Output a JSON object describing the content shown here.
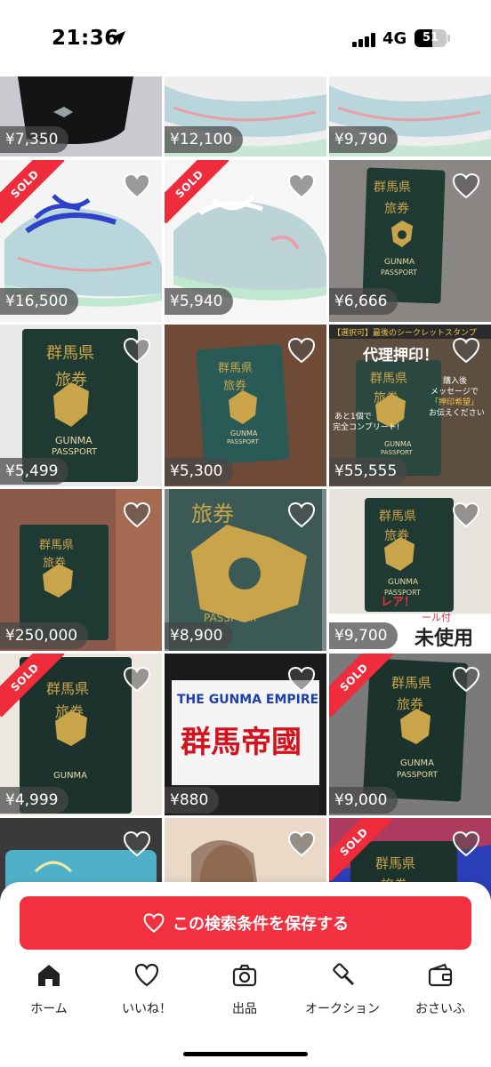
{
  "status_bar": {
    "time": "21:36",
    "network": "4G",
    "battery": "51"
  },
  "items": [
    {
      "price": "¥7,350",
      "sold": false
    },
    {
      "price": "¥12,100",
      "sold": false
    },
    {
      "price": "¥9,790",
      "sold": false
    },
    {
      "price": "¥16,500",
      "sold": true
    },
    {
      "price": "¥5,940",
      "sold": true
    },
    {
      "price": "¥6,666",
      "sold": false
    },
    {
      "price": "¥5,499",
      "sold": false
    },
    {
      "price": "¥5,300",
      "sold": false
    },
    {
      "price": "¥55,555",
      "sold": false
    },
    {
      "price": "¥250,000",
      "sold": false
    },
    {
      "price": "¥8,900",
      "sold": false
    },
    {
      "price": "¥9,700",
      "sold": false
    },
    {
      "price": "¥4,999",
      "sold": true
    },
    {
      "price": "¥880",
      "sold": false
    },
    {
      "price": "¥9,000",
      "sold": true
    },
    {
      "price": "",
      "sold": false
    },
    {
      "price": "",
      "sold": false
    },
    {
      "price": "",
      "sold": true
    }
  ],
  "sold_label": "SOLD",
  "passport_text": {
    "line1": "群馬県",
    "line2": "旅券",
    "en1": "GUNMA",
    "en2": "PASSPORT"
  },
  "overlay_texts": {
    "promo_banner": "【選択可】最後のシークレットスタンプ",
    "promo_title": "代理押印！",
    "promo_note1": "購入後",
    "promo_note2": "メッセージで",
    "promo_note3": "「押印希望」",
    "promo_note4": "お伝えください",
    "promo_left1": "あと1個で",
    "promo_left2": "完全コンプリート!",
    "rare": "レア！",
    "sticker": "ール付",
    "unused": "未使用",
    "empire_en": "THE GUNMA EMPIRE",
    "empire_jp": "群馬帝國"
  },
  "save_search_label": "この検索条件を保存する",
  "tabs": [
    {
      "label": "ホーム",
      "icon": "home-icon"
    },
    {
      "label": "いいね！",
      "icon": "heart-icon"
    },
    {
      "label": "出品",
      "icon": "camera-icon"
    },
    {
      "label": "オークション",
      "icon": "gavel-icon"
    },
    {
      "label": "おさいふ",
      "icon": "wallet-icon"
    }
  ],
  "colors": {
    "accent": "#f1313f",
    "sold": "#ee2c3c",
    "passport": "#1f3a33",
    "gold": "#c9a44a"
  }
}
